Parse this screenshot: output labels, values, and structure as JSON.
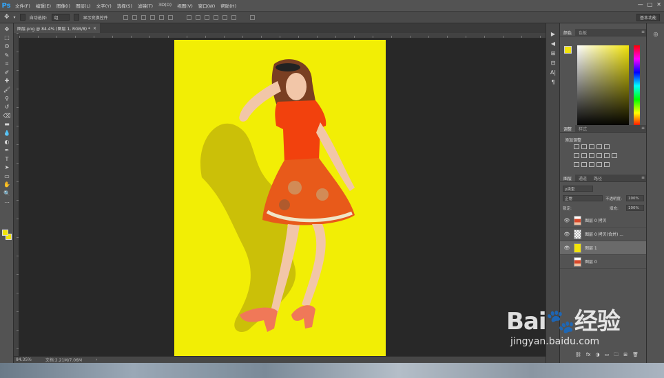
{
  "app": {
    "logo": "Ps"
  },
  "menubar": {
    "items": [
      "文件(F)",
      "编辑(E)",
      "图像(I)",
      "图层(L)",
      "文字(Y)",
      "选择(S)",
      "滤镜(T)",
      "3D(D)",
      "视图(V)",
      "窗口(W)",
      "帮助(H)"
    ],
    "window_controls": [
      "—",
      "□",
      "✕"
    ]
  },
  "options_bar": {
    "auto_select_label": "自动选择:",
    "auto_select_value": "组",
    "show_transform_label": "显示变换控件",
    "workspace": "基本功能"
  },
  "document": {
    "tab_title": "图层.png @ 84.4% (图层 1, RGB/8) *",
    "close_glyph": "×",
    "canvas_color": "#f2ee05"
  },
  "status": {
    "zoom": "84.35%",
    "doc_info": "文档:2.21M/7.06M",
    "arrow": "›"
  },
  "tools": {
    "icons": [
      "move-icon",
      "marquee-icon",
      "lasso-icon",
      "quick-select-icon",
      "crop-icon",
      "eyedropper-icon",
      "healing-icon",
      "brush-icon",
      "stamp-icon",
      "history-brush-icon",
      "eraser-icon",
      "gradient-icon",
      "blur-icon",
      "dodge-icon",
      "pen-icon",
      "type-icon",
      "path-select-icon",
      "shape-icon",
      "hand-icon",
      "zoom-icon",
      "more-icon"
    ],
    "glyphs": [
      "✥",
      "⬚",
      "ʘ",
      "✎",
      "⌗",
      "✐",
      "✚",
      "🖌",
      "⚲",
      "↺",
      "⌫",
      "▬",
      "💧",
      "◐",
      "✒",
      "T",
      "➤",
      "▭",
      "✋",
      "🔍",
      "⋯"
    ],
    "foreground_color": "#f2e40b",
    "background_color": "#f2e40b"
  },
  "color_panel": {
    "tabs": [
      "颜色",
      "色板"
    ],
    "menu": "≡",
    "current_color": "#f2e40b"
  },
  "adjustments_panel": {
    "tabs": [
      "调整",
      "样式"
    ],
    "menu": "≡",
    "title": "添加调整"
  },
  "layers_panel": {
    "tabs": [
      "图层",
      "通道",
      "路径"
    ],
    "menu": "≡",
    "filter": "ρ类型",
    "blend_mode": "正常",
    "opacity_label": "不透明度:",
    "opacity_value": "100%",
    "lock_label": "锁定:",
    "fill_label": "填充:",
    "fill_value": "100%",
    "layers": [
      {
        "name": "图层 0 拷贝",
        "visible": true,
        "thumb": "photo"
      },
      {
        "name": "图层 0 拷贝(合并) ...",
        "visible": true,
        "thumb": "transparent"
      },
      {
        "name": "图层 1",
        "visible": true,
        "thumb": "yellow",
        "selected": true
      },
      {
        "name": "图层 0",
        "visible": false,
        "thumb": "photo"
      }
    ],
    "footer_icons": [
      "⛓",
      "fx",
      "◑",
      "▭",
      "🗀",
      "⊞",
      "🗑"
    ]
  },
  "panel_strip": {
    "glyphs": [
      "▶",
      "◀",
      "⊞",
      "⊟",
      "A|",
      "¶"
    ]
  },
  "watermark": {
    "brand": "Bai🐾经验",
    "url": "jingyan.baidu.com"
  }
}
